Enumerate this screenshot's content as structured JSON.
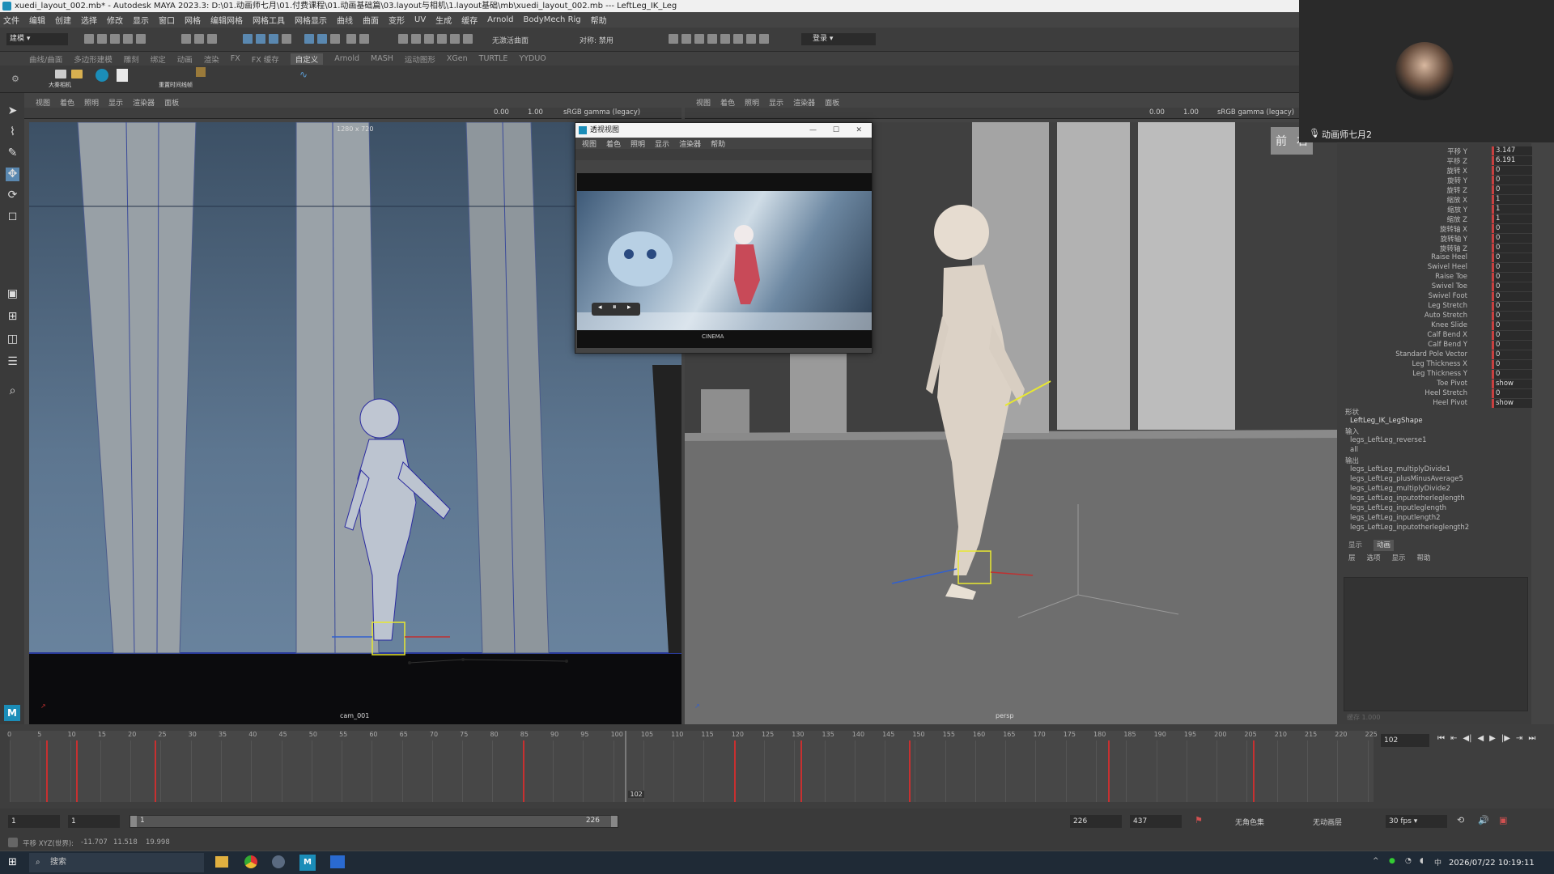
{
  "window": {
    "title": "xuedi_layout_002.mb* - Autodesk MAYA 2023.3: D:\\01.动画师七月\\01.付费课程\\01.动画基础篇\\03.layout与相机\\1.layout基础\\mb\\xuedi_layout_002.mb   ---   LeftLeg_IK_Leg"
  },
  "menubar": {
    "items": [
      "文件",
      "编辑",
      "创建",
      "选择",
      "修改",
      "显示",
      "窗口",
      "网格",
      "编辑网格",
      "网格工具",
      "网格显示",
      "曲线",
      "曲面",
      "变形",
      "UV",
      "生成",
      "缓存",
      "Arnold",
      "BodyMech Rig",
      "帮助"
    ]
  },
  "statusline": {
    "mode": "建模",
    "symmetry_label": "无激活曲面",
    "symmetry_value": "对称: 禁用",
    "login": "登录"
  },
  "shelf": {
    "tabs": [
      "曲线/曲面",
      "多边形建模",
      "雕刻",
      "绑定",
      "动画",
      "渲染",
      "FX",
      "FX 缓存",
      "自定义",
      "Arnold",
      "MASH",
      "运动图形",
      "XGen",
      "TURTLE",
      "YYDUO"
    ],
    "active_tab": "自定义",
    "items": [
      "大秦相机",
      "重置时间线帧"
    ]
  },
  "viewport_left": {
    "menu": [
      "视图",
      "着色",
      "照明",
      "显示",
      "渲染器",
      "面板"
    ],
    "exposure": "0.00",
    "gamma": "1.00",
    "colorspace": "sRGB gamma (legacy)",
    "resolution": "1280 x 720",
    "camera": "cam_001"
  },
  "viewport_right": {
    "menu": [
      "视图",
      "着色",
      "照明",
      "显示",
      "渲染器",
      "面板"
    ],
    "exposure": "0.00",
    "gamma": "1.00",
    "colorspace": "sRGB gamma (legacy)",
    "camera": "persp",
    "viewcube": [
      "前",
      "右"
    ]
  },
  "float_window": {
    "title": "透视视图",
    "menu": [
      "视图",
      "着色",
      "照明",
      "显示",
      "渲染器",
      "帮助"
    ],
    "image_caption": "CINEMA"
  },
  "camera_feed": {
    "user": "动画师七月2"
  },
  "channel_box": {
    "attributes": [
      {
        "name": "平移 Y",
        "value": "3.147"
      },
      {
        "name": "平移 Z",
        "value": "6.191"
      },
      {
        "name": "旋转 X",
        "value": "0"
      },
      {
        "name": "旋转 Y",
        "value": "0"
      },
      {
        "name": "旋转 Z",
        "value": "0"
      },
      {
        "name": "缩放 X",
        "value": "1"
      },
      {
        "name": "缩放 Y",
        "value": "1"
      },
      {
        "name": "缩放 Z",
        "value": "1"
      },
      {
        "name": "旋转轴 X",
        "value": "0"
      },
      {
        "name": "旋转轴 Y",
        "value": "0"
      },
      {
        "name": "旋转轴 Z",
        "value": "0"
      },
      {
        "name": "Raise Heel",
        "value": "0"
      },
      {
        "name": "Swivel Heel",
        "value": "0"
      },
      {
        "name": "Raise Toe",
        "value": "0"
      },
      {
        "name": "Swivel Toe",
        "value": "0"
      },
      {
        "name": "Swivel Foot",
        "value": "0"
      },
      {
        "name": "Leg Stretch",
        "value": "0"
      },
      {
        "name": "Auto Stretch",
        "value": "0"
      },
      {
        "name": "Knee Slide",
        "value": "0"
      },
      {
        "name": "Calf Bend X",
        "value": "0"
      },
      {
        "name": "Calf Bend Y",
        "value": "0"
      },
      {
        "name": "Standard Pole Vector",
        "value": "0"
      },
      {
        "name": "Leg Thickness X",
        "value": "0"
      },
      {
        "name": "Leg Thickness Y",
        "value": "0"
      },
      {
        "name": "Toe Pivot",
        "value": "show"
      },
      {
        "name": "Heel Stretch",
        "value": "0"
      },
      {
        "name": "Heel Pivot",
        "value": "show"
      }
    ],
    "shapes_header": "形状",
    "shape_node": "LeftLeg_IK_LegShape",
    "inputs_header": "输入",
    "inputs": [
      "legs_LeftLeg_reverse1",
      "all"
    ],
    "outputs_header": "输出",
    "outputs": [
      "legs_LeftLeg_multiplyDivide1",
      "legs_LeftLeg_plusMinusAverage5",
      "legs_LeftLeg_multiplyDivide2",
      "legs_LeftLeg_inputotherleglength",
      "legs_LeftLeg_inputleglength",
      "legs_LeftLeg_inputlength2",
      "legs_LeftLeg_inputotherleglength2"
    ]
  },
  "layer_editor": {
    "tabs": [
      "显示",
      "动画"
    ],
    "menu": [
      "层",
      "选项",
      "显示",
      "帮助"
    ],
    "footer": "缓存 1.000"
  },
  "timeline": {
    "ticks": [
      "0",
      "5",
      "10",
      "15",
      "20",
      "25",
      "30",
      "35",
      "40",
      "45",
      "50",
      "55",
      "60",
      "65",
      "70",
      "75",
      "80",
      "85",
      "90",
      "95",
      "100",
      "105",
      "110",
      "115",
      "120",
      "125",
      "130",
      "135",
      "140",
      "145",
      "150",
      "155",
      "160",
      "165",
      "170",
      "175",
      "180",
      "185",
      "190",
      "195",
      "200",
      "205",
      "210",
      "215",
      "220",
      "225"
    ],
    "keys": [
      6,
      11,
      24,
      85,
      102,
      120,
      131,
      149,
      182,
      206
    ],
    "current_frame": "102",
    "frame_field": "102"
  },
  "range": {
    "start": "1",
    "anim_start": "1",
    "slider_start": "1",
    "slider_end": "226",
    "end": "226",
    "anim_end": "437",
    "character_set": "无角色集",
    "anim_layer": "无动画层",
    "fps": "30 fps"
  },
  "commandline": {
    "label": "平移 XYZ(世界):",
    "x": "-11.707",
    "y": "11.518",
    "z": "19.998"
  },
  "taskbar": {
    "search": "搜索",
    "datetime": "2026/07/22 10:19:11"
  }
}
